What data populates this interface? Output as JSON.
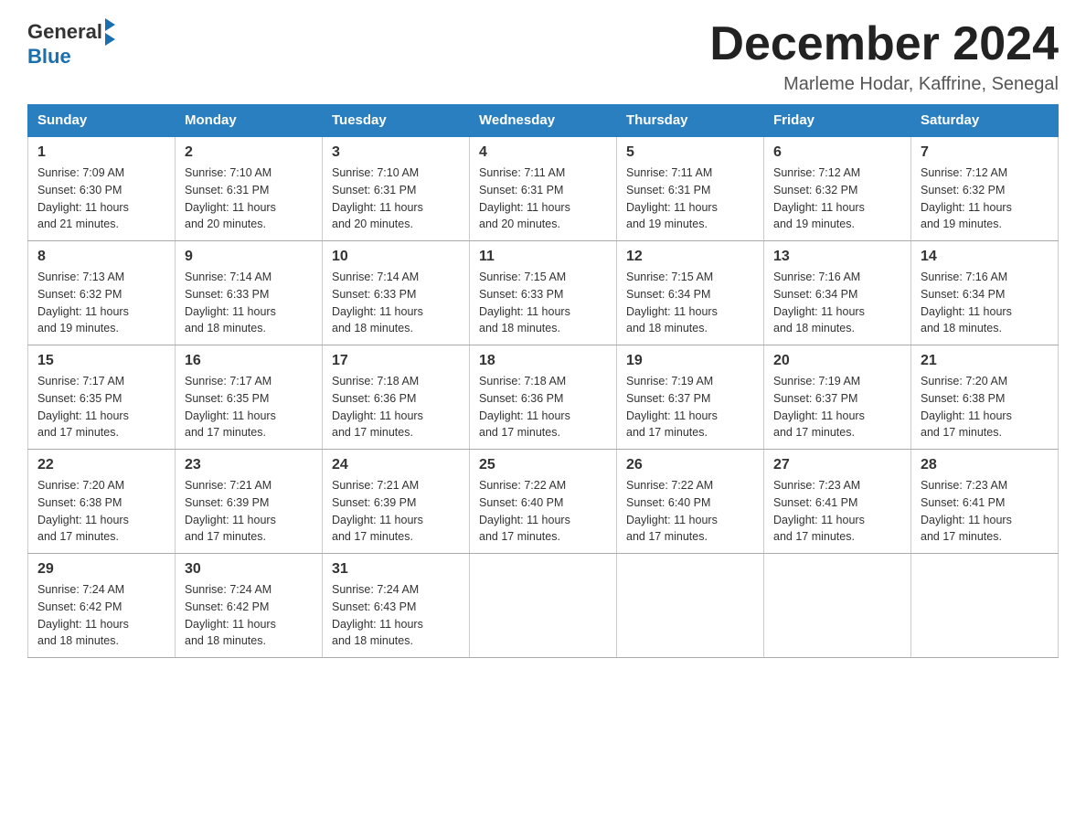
{
  "header": {
    "logo": {
      "general": "General",
      "blue": "Blue"
    },
    "title": "December 2024",
    "subtitle": "Marleme Hodar, Kaffrine, Senegal"
  },
  "days_of_week": [
    "Sunday",
    "Monday",
    "Tuesday",
    "Wednesday",
    "Thursday",
    "Friday",
    "Saturday"
  ],
  "weeks": [
    [
      {
        "day": "1",
        "sunrise": "7:09 AM",
        "sunset": "6:30 PM",
        "daylight": "11 hours and 21 minutes."
      },
      {
        "day": "2",
        "sunrise": "7:10 AM",
        "sunset": "6:31 PM",
        "daylight": "11 hours and 20 minutes."
      },
      {
        "day": "3",
        "sunrise": "7:10 AM",
        "sunset": "6:31 PM",
        "daylight": "11 hours and 20 minutes."
      },
      {
        "day": "4",
        "sunrise": "7:11 AM",
        "sunset": "6:31 PM",
        "daylight": "11 hours and 20 minutes."
      },
      {
        "day": "5",
        "sunrise": "7:11 AM",
        "sunset": "6:31 PM",
        "daylight": "11 hours and 19 minutes."
      },
      {
        "day": "6",
        "sunrise": "7:12 AM",
        "sunset": "6:32 PM",
        "daylight": "11 hours and 19 minutes."
      },
      {
        "day": "7",
        "sunrise": "7:12 AM",
        "sunset": "6:32 PM",
        "daylight": "11 hours and 19 minutes."
      }
    ],
    [
      {
        "day": "8",
        "sunrise": "7:13 AM",
        "sunset": "6:32 PM",
        "daylight": "11 hours and 19 minutes."
      },
      {
        "day": "9",
        "sunrise": "7:14 AM",
        "sunset": "6:33 PM",
        "daylight": "11 hours and 18 minutes."
      },
      {
        "day": "10",
        "sunrise": "7:14 AM",
        "sunset": "6:33 PM",
        "daylight": "11 hours and 18 minutes."
      },
      {
        "day": "11",
        "sunrise": "7:15 AM",
        "sunset": "6:33 PM",
        "daylight": "11 hours and 18 minutes."
      },
      {
        "day": "12",
        "sunrise": "7:15 AM",
        "sunset": "6:34 PM",
        "daylight": "11 hours and 18 minutes."
      },
      {
        "day": "13",
        "sunrise": "7:16 AM",
        "sunset": "6:34 PM",
        "daylight": "11 hours and 18 minutes."
      },
      {
        "day": "14",
        "sunrise": "7:16 AM",
        "sunset": "6:34 PM",
        "daylight": "11 hours and 18 minutes."
      }
    ],
    [
      {
        "day": "15",
        "sunrise": "7:17 AM",
        "sunset": "6:35 PM",
        "daylight": "11 hours and 17 minutes."
      },
      {
        "day": "16",
        "sunrise": "7:17 AM",
        "sunset": "6:35 PM",
        "daylight": "11 hours and 17 minutes."
      },
      {
        "day": "17",
        "sunrise": "7:18 AM",
        "sunset": "6:36 PM",
        "daylight": "11 hours and 17 minutes."
      },
      {
        "day": "18",
        "sunrise": "7:18 AM",
        "sunset": "6:36 PM",
        "daylight": "11 hours and 17 minutes."
      },
      {
        "day": "19",
        "sunrise": "7:19 AM",
        "sunset": "6:37 PM",
        "daylight": "11 hours and 17 minutes."
      },
      {
        "day": "20",
        "sunrise": "7:19 AM",
        "sunset": "6:37 PM",
        "daylight": "11 hours and 17 minutes."
      },
      {
        "day": "21",
        "sunrise": "7:20 AM",
        "sunset": "6:38 PM",
        "daylight": "11 hours and 17 minutes."
      }
    ],
    [
      {
        "day": "22",
        "sunrise": "7:20 AM",
        "sunset": "6:38 PM",
        "daylight": "11 hours and 17 minutes."
      },
      {
        "day": "23",
        "sunrise": "7:21 AM",
        "sunset": "6:39 PM",
        "daylight": "11 hours and 17 minutes."
      },
      {
        "day": "24",
        "sunrise": "7:21 AM",
        "sunset": "6:39 PM",
        "daylight": "11 hours and 17 minutes."
      },
      {
        "day": "25",
        "sunrise": "7:22 AM",
        "sunset": "6:40 PM",
        "daylight": "11 hours and 17 minutes."
      },
      {
        "day": "26",
        "sunrise": "7:22 AM",
        "sunset": "6:40 PM",
        "daylight": "11 hours and 17 minutes."
      },
      {
        "day": "27",
        "sunrise": "7:23 AM",
        "sunset": "6:41 PM",
        "daylight": "11 hours and 17 minutes."
      },
      {
        "day": "28",
        "sunrise": "7:23 AM",
        "sunset": "6:41 PM",
        "daylight": "11 hours and 17 minutes."
      }
    ],
    [
      {
        "day": "29",
        "sunrise": "7:24 AM",
        "sunset": "6:42 PM",
        "daylight": "11 hours and 18 minutes."
      },
      {
        "day": "30",
        "sunrise": "7:24 AM",
        "sunset": "6:42 PM",
        "daylight": "11 hours and 18 minutes."
      },
      {
        "day": "31",
        "sunrise": "7:24 AM",
        "sunset": "6:43 PM",
        "daylight": "11 hours and 18 minutes."
      },
      null,
      null,
      null,
      null
    ]
  ]
}
